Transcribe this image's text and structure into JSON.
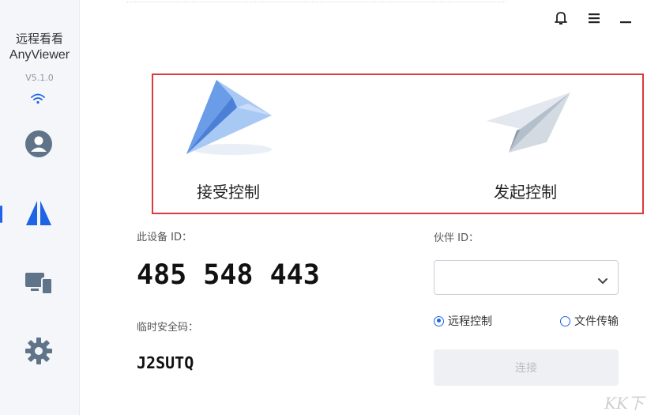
{
  "app": {
    "name_cn": "远程看看",
    "name_en": "AnyViewer",
    "version": "V5.1.0"
  },
  "sidebar": {
    "items": [
      {
        "name": "account",
        "icon": "user-icon"
      },
      {
        "name": "remote",
        "icon": "anyviewer-logo-icon",
        "active": true
      },
      {
        "name": "devices",
        "icon": "devices-icon"
      },
      {
        "name": "settings",
        "icon": "gear-icon"
      }
    ]
  },
  "topbar": {
    "icons": [
      "bell-icon",
      "menu-icon",
      "minimize-icon"
    ]
  },
  "modes": {
    "receive_label": "接受控制",
    "initiate_label": "发起控制"
  },
  "device": {
    "id_label": "此设备 ID：",
    "id": "485 548 443",
    "pwd_label": "临时安全码：",
    "pwd": "J2SUTQ"
  },
  "partner": {
    "label": "伙伴 ID：",
    "value": "",
    "placeholder": ""
  },
  "options": {
    "remote_label": "远程控制",
    "file_label": "文件传输",
    "selected": "remote"
  },
  "connect": {
    "label": "连接"
  },
  "colors": {
    "accent": "#1e64e6",
    "highlight": "#d93a3a"
  },
  "watermark": "KK下"
}
